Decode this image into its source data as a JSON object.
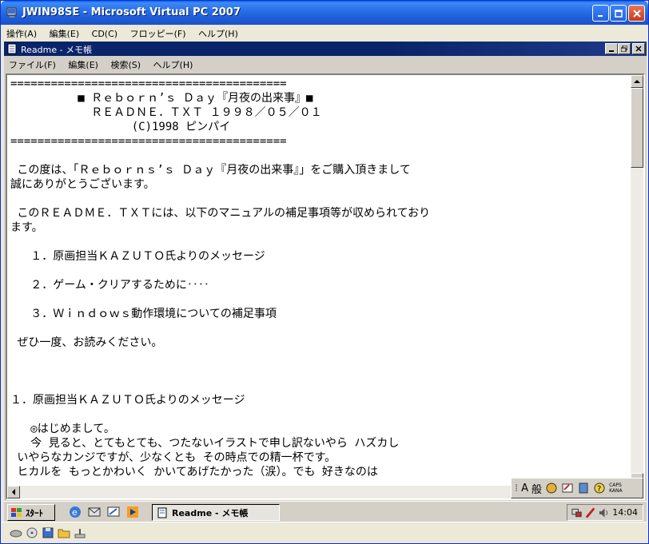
{
  "vpc": {
    "title": "JWIN98SE - Microsoft Virtual PC 2007",
    "menu": [
      "操作(A)",
      "編集(E)",
      "CD(C)",
      "フロッピー(F)",
      "ヘルプ(H)"
    ]
  },
  "notepad": {
    "title": "Readme - メモ帳",
    "menu": [
      "ファイル(F)",
      "編集(E)",
      "検索(S)",
      "ヘルプ(H)"
    ],
    "lines": [
      "=========================================",
      "          ■ Ｒｅｂｏｒｎ’ｓ Ｄａｙ『月夜の出来事』■",
      "            ＲＥＡＤＮＥ．ＴＸＴ １９９８／０５／０１",
      "                  (C)1998 ピンパイ",
      "=========================================",
      "",
      " この度は、「Ｒｅｂｏｒｎｓ’ｓ Ｄａｙ『月夜の出来事』」をご購入頂きまして",
      "誠にありがとうございます。",
      "",
      " このＲＥＡＤＭＥ．ＴＸＴには、以下のマニュアルの補足事項等が収められており",
      "ます。",
      "",
      "   １．原画担当ＫＡＺＵＴＯ氏よりのメッセージ",
      "",
      "   ２．ゲーム・クリアするために‥‥",
      "",
      "   ３．Ｗｉｎｄｏｗｓ動作環境についての補足事項",
      "",
      " ぜひ一度、お読みください。",
      "",
      "",
      "",
      "１．原画担当ＫＡＺＵＴＯ氏よりのメッセージ",
      "",
      "   ◎はじめまして。",
      "   今 見ると、とてもとても、つたないイラストで申し訳ないやら ハズカし",
      " いやらなカンジですが、少なくとも その時点での精一杯です。",
      " ヒカルを もっとかわいく かいてあげたかった（涙）。でも 好きなのは"
    ]
  },
  "ime": {
    "mode": "A",
    "kanji": "般",
    "caps_label": "CAPS",
    "kana_label": "KANA"
  },
  "taskbar": {
    "start_label": "ｽﾀｰﾄ",
    "task_label": "Readme - メモ帳",
    "clock": "14:04"
  },
  "colors": {
    "xp_title": "#2B6FE8",
    "w98_title": "#0A246A",
    "face": "#D4D0C8"
  }
}
